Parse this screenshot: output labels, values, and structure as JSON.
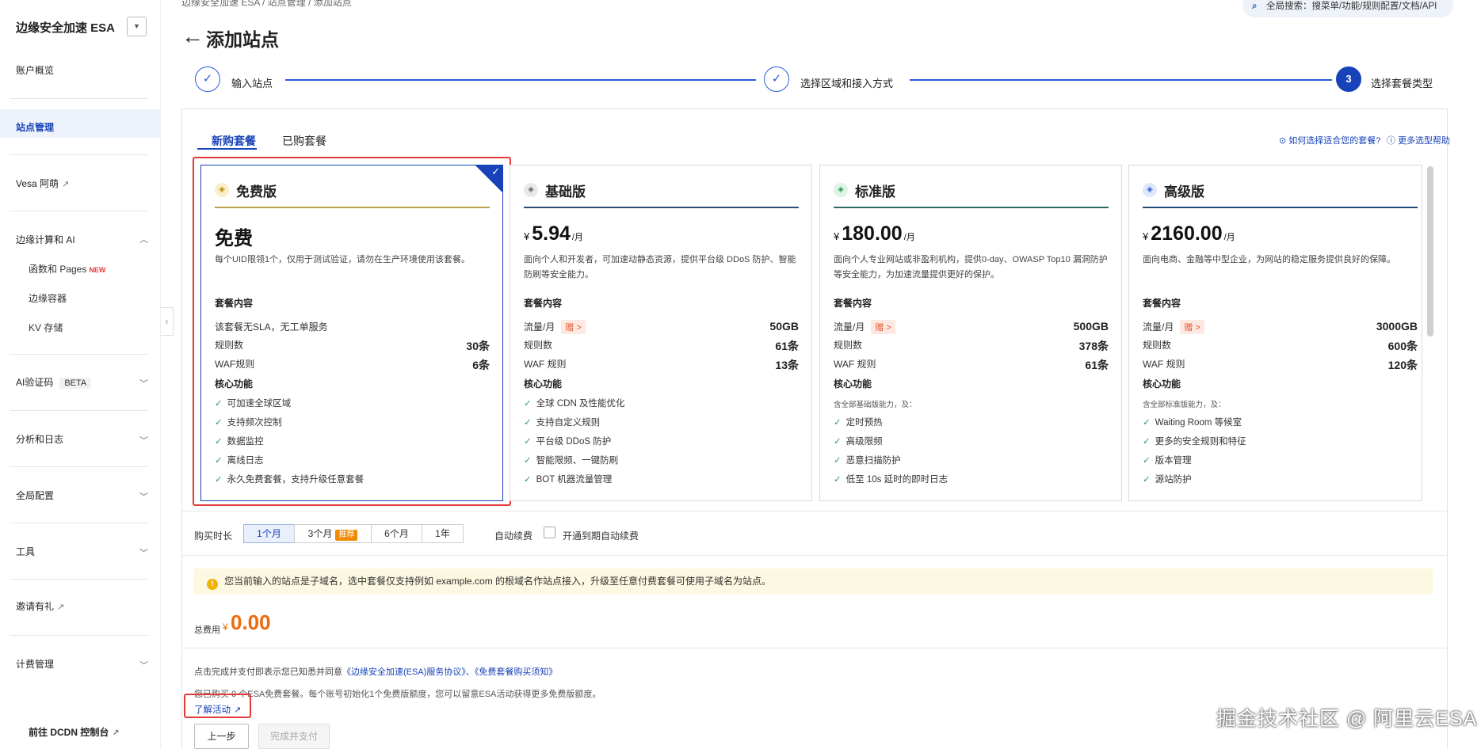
{
  "sidebar": {
    "title": "边缘安全加速 ESA",
    "items": {
      "overview": "账户概览",
      "sites": "站点管理",
      "vesa": "Vesa 阿萌",
      "edge": "边缘计算和 AI",
      "functions": "函数和 Pages",
      "functions_tag": "NEW",
      "container": "边缘容器",
      "kv": "KV 存储",
      "captcha": "AI验证码",
      "captcha_tag": "BETA",
      "analytics": "分析和日志",
      "global": "全局配置",
      "tools": "工具",
      "invite": "邀请有礼",
      "billing": "计费管理",
      "dcdn": "前往 DCDN 控制台"
    }
  },
  "header": {
    "breadcrumb": "边缘安全加速 ESA  /  站点管理  /  添加站点",
    "search": "全局搜索：搜菜单/功能/规则配置/文档/API",
    "title": "添加站点"
  },
  "steps": [
    {
      "label": "输入站点",
      "mark": "✓"
    },
    {
      "label": "选择区域和接入方式",
      "mark": "✓"
    },
    {
      "label": "选择套餐类型",
      "mark": "3"
    }
  ],
  "tabs": {
    "new": "新购套餐",
    "bought": "已购套餐"
  },
  "help": {
    "how": "如何选择适合您的套餐?",
    "more": "更多选型帮助"
  },
  "plans": [
    {
      "name": "免费版",
      "price_text": "免费",
      "desc": "每个UID限领1个，仅用于测试验证，请勿在生产环境使用该套餐。",
      "content_title": "套餐内容",
      "sla": "该套餐无SLA，无工单服务",
      "rules_label": "规则数",
      "rules": "30条",
      "waf_label": "WAF规则",
      "waf": "6条",
      "core_title": "核心功能",
      "features": [
        "可加速全球区域",
        "支持频次控制",
        "数据监控",
        "离线日志",
        "永久免费套餐，支持升级任意套餐"
      ]
    },
    {
      "name": "基础版",
      "currency": "¥",
      "price": "5.94",
      "unit": "/月",
      "desc": "面向个人和开发者，可加速动静态资源，提供平台级 DDoS 防护、智能防刷等安全能力。",
      "content_title": "套餐内容",
      "traffic_label": "流量/月",
      "gift": "赠 >",
      "traffic": "50GB",
      "rules_label": "规则数",
      "rules": "61条",
      "waf_label": "WAF 规则",
      "waf": "13条",
      "core_title": "核心功能",
      "features": [
        "全球 CDN 及性能优化",
        "支持自定义规则",
        "平台级 DDoS 防护",
        "智能限频、一键防刷",
        "BOT 机器流量管理"
      ]
    },
    {
      "name": "标准版",
      "currency": "¥",
      "price": "180.00",
      "unit": "/月",
      "desc": "面向个人专业网站或非盈利机构，提供0-day、OWASP Top10 漏洞防护等安全能力，为加速流量提供更好的保护。",
      "content_title": "套餐内容",
      "traffic_label": "流量/月",
      "gift": "赠 >",
      "traffic": "500GB",
      "rules_label": "规则数",
      "rules": "378条",
      "waf_label": "WAF 规则",
      "waf": "61条",
      "core_title": "核心功能",
      "note": "含全部基础版能力，及：",
      "features": [
        "定时预热",
        "高级限频",
        "恶意扫描防护",
        "低至 10s 延时的即时日志"
      ]
    },
    {
      "name": "高级版",
      "currency": "¥",
      "price": "2160.00",
      "unit": "/月",
      "desc": "面向电商、金融等中型企业，为网站的稳定服务提供良好的保障。",
      "content_title": "套餐内容",
      "traffic_label": "流量/月",
      "gift": "赠 >",
      "traffic": "3000GB",
      "rules_label": "规则数",
      "rules": "600条",
      "waf_label": "WAF 规则",
      "waf": "120条",
      "core_title": "核心功能",
      "note": "含全部标准版能力，及：",
      "features": [
        "Waiting Room 等候室",
        "更多的安全规则和特征",
        "版本管理",
        "源站防护"
      ]
    }
  ],
  "duration": {
    "label": "购买时长",
    "options": [
      "1个月",
      "3个月",
      "6个月",
      "1年"
    ],
    "recommend": "推荐",
    "auto_label": "自动续费",
    "auto_check": "开通到期自动续费"
  },
  "notice": "您当前输入的站点是子域名，选中套餐仅支持例如 example.com 的根域名作站点接入，升级至任意付费套餐可使用子域名为站点。",
  "total": {
    "label": "总费用",
    "currency": "¥",
    "value": "0.00"
  },
  "agreement": {
    "prefix": "点击完成并支付即表示您已知悉并同意",
    "link1": "《边缘安全加速(ESA)服务协议》",
    "sep": "、",
    "link2": "《免费套餐购买须知》"
  },
  "info": "您已购买 0 个ESA免费套餐。每个账号初始化1个免费版额度，您可以留意ESA活动获得更多免费版额度。",
  "activity_link": "了解活动",
  "buttons": {
    "prev": "上一步",
    "finish": "完成并支付"
  },
  "watermark": "掘金技术社区 @ 阿里云ESA",
  "colors": {
    "accent": "#1742b8",
    "highlight": "#e23a3a",
    "price": "#ee6a0a",
    "check": "#2e9e5a"
  }
}
